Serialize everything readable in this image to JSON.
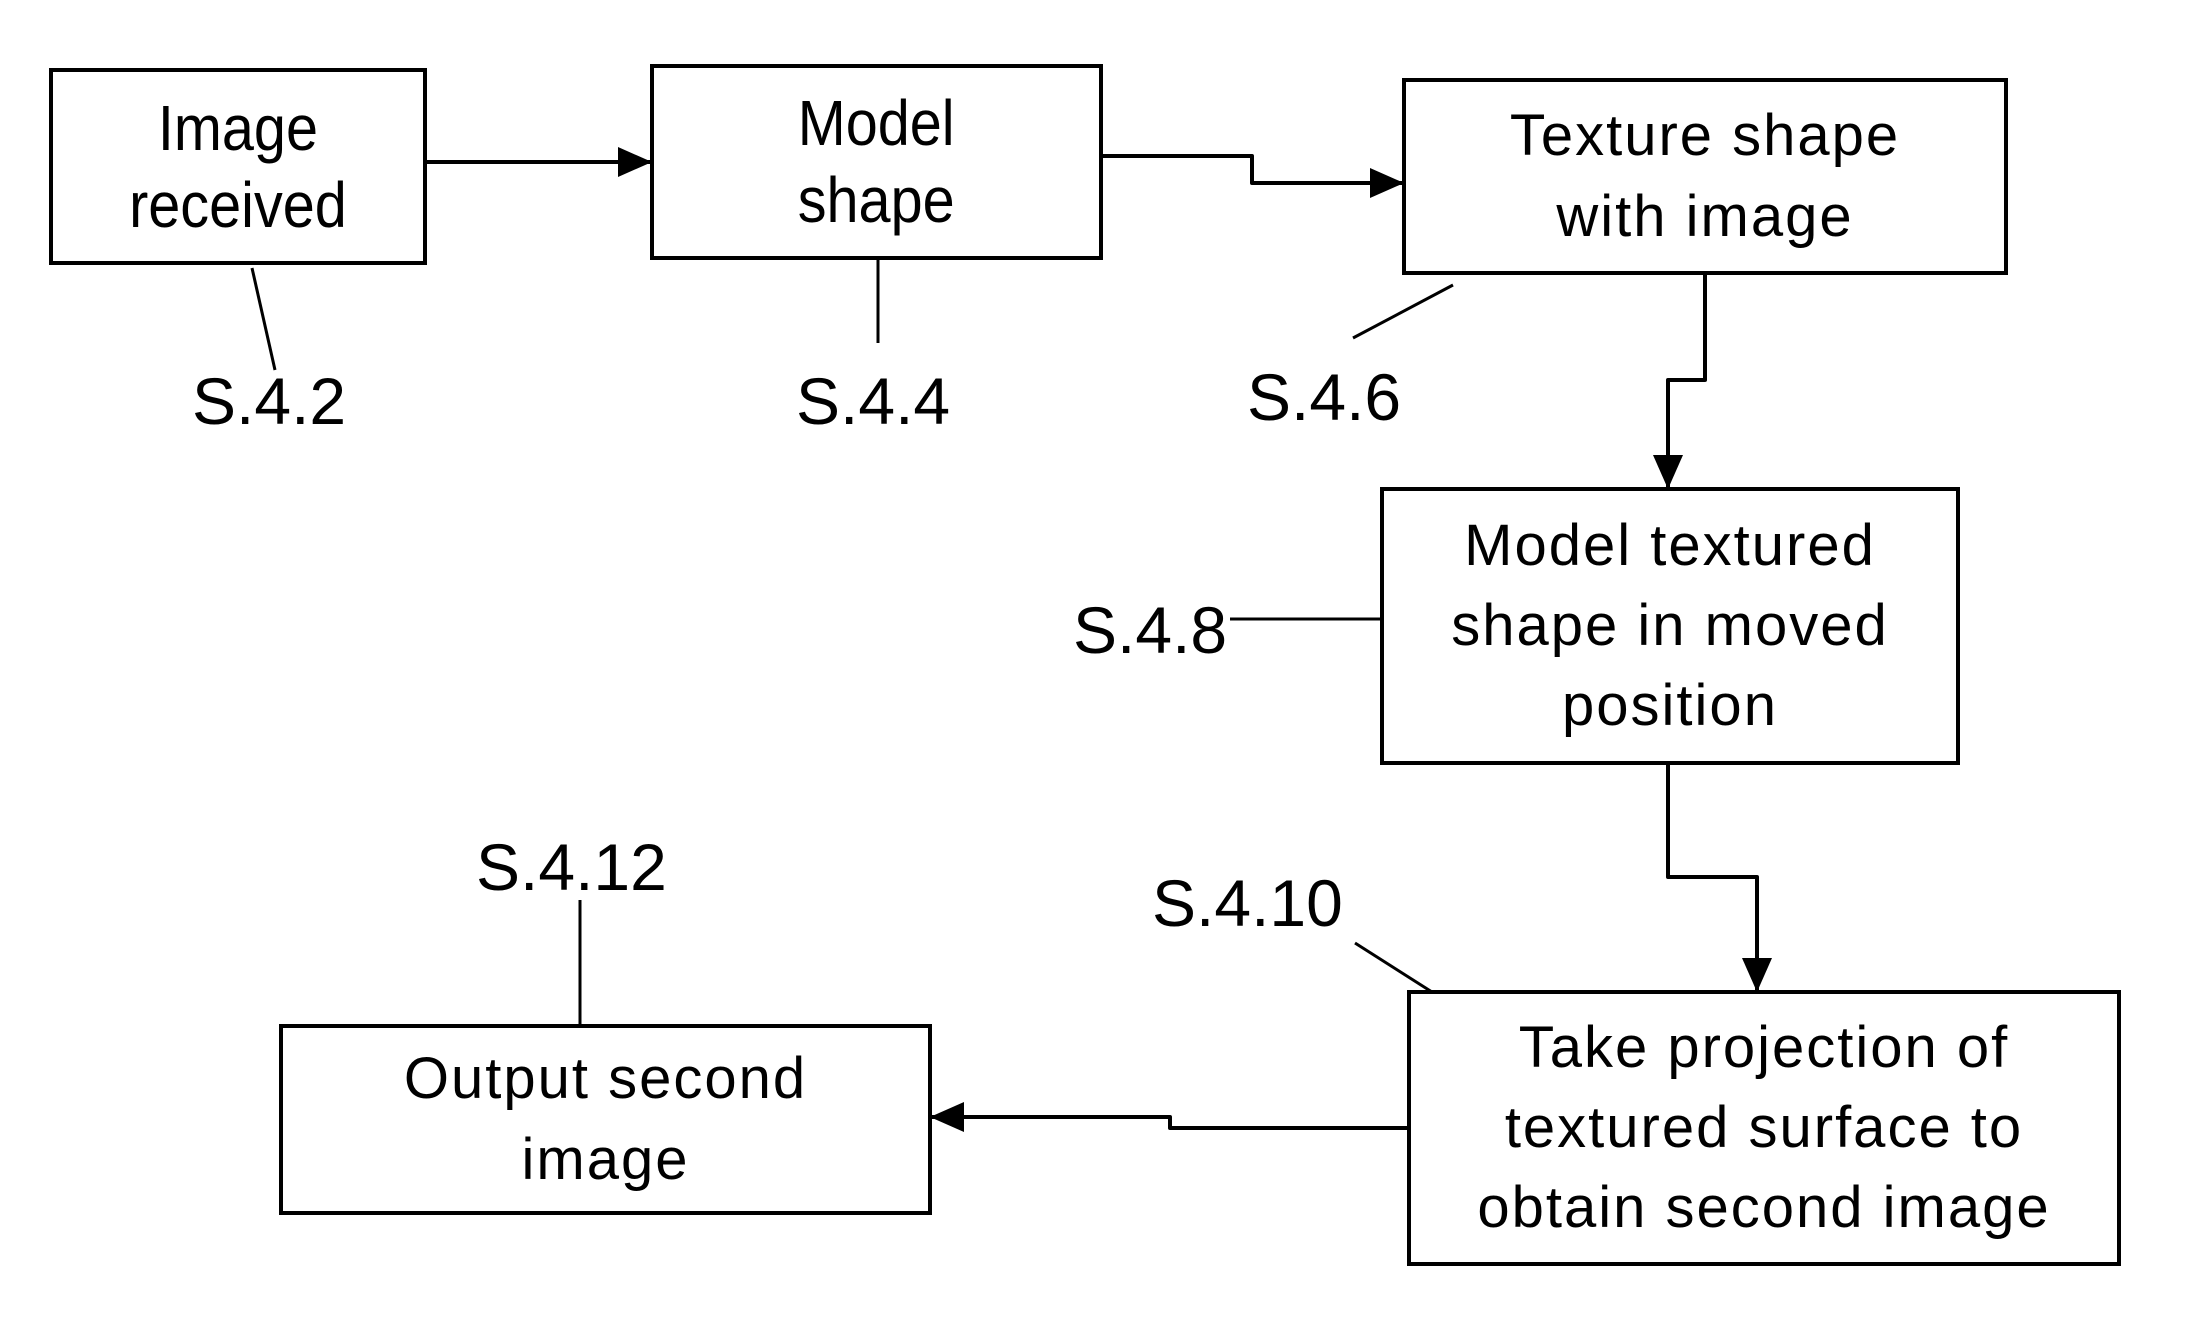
{
  "diagram": {
    "type": "flowchart",
    "steps": [
      {
        "id": "S.4.2",
        "label": "S.4.2",
        "lines": [
          "Image",
          "received"
        ]
      },
      {
        "id": "S.4.4",
        "label": "S.4.4",
        "lines": [
          "Model",
          "shape"
        ]
      },
      {
        "id": "S.4.6",
        "label": "S.4.6",
        "lines": [
          "Texture shape",
          "with image"
        ]
      },
      {
        "id": "S.4.8",
        "label": "S.4.8",
        "lines": [
          "Model textured",
          "shape in moved",
          "position"
        ]
      },
      {
        "id": "S.4.10",
        "label": "S.4.10",
        "lines": [
          "Take projection of",
          "textured surface to",
          "obtain second image"
        ]
      },
      {
        "id": "S.4.12",
        "label": "S.4.12",
        "lines": [
          "Output second",
          "image"
        ]
      }
    ],
    "edges": [
      {
        "from": "S.4.2",
        "to": "S.4.4"
      },
      {
        "from": "S.4.4",
        "to": "S.4.6"
      },
      {
        "from": "S.4.6",
        "to": "S.4.8"
      },
      {
        "from": "S.4.8",
        "to": "S.4.10"
      },
      {
        "from": "S.4.10",
        "to": "S.4.12"
      }
    ],
    "colors": {
      "stroke": "#000000",
      "background": "#ffffff"
    }
  }
}
